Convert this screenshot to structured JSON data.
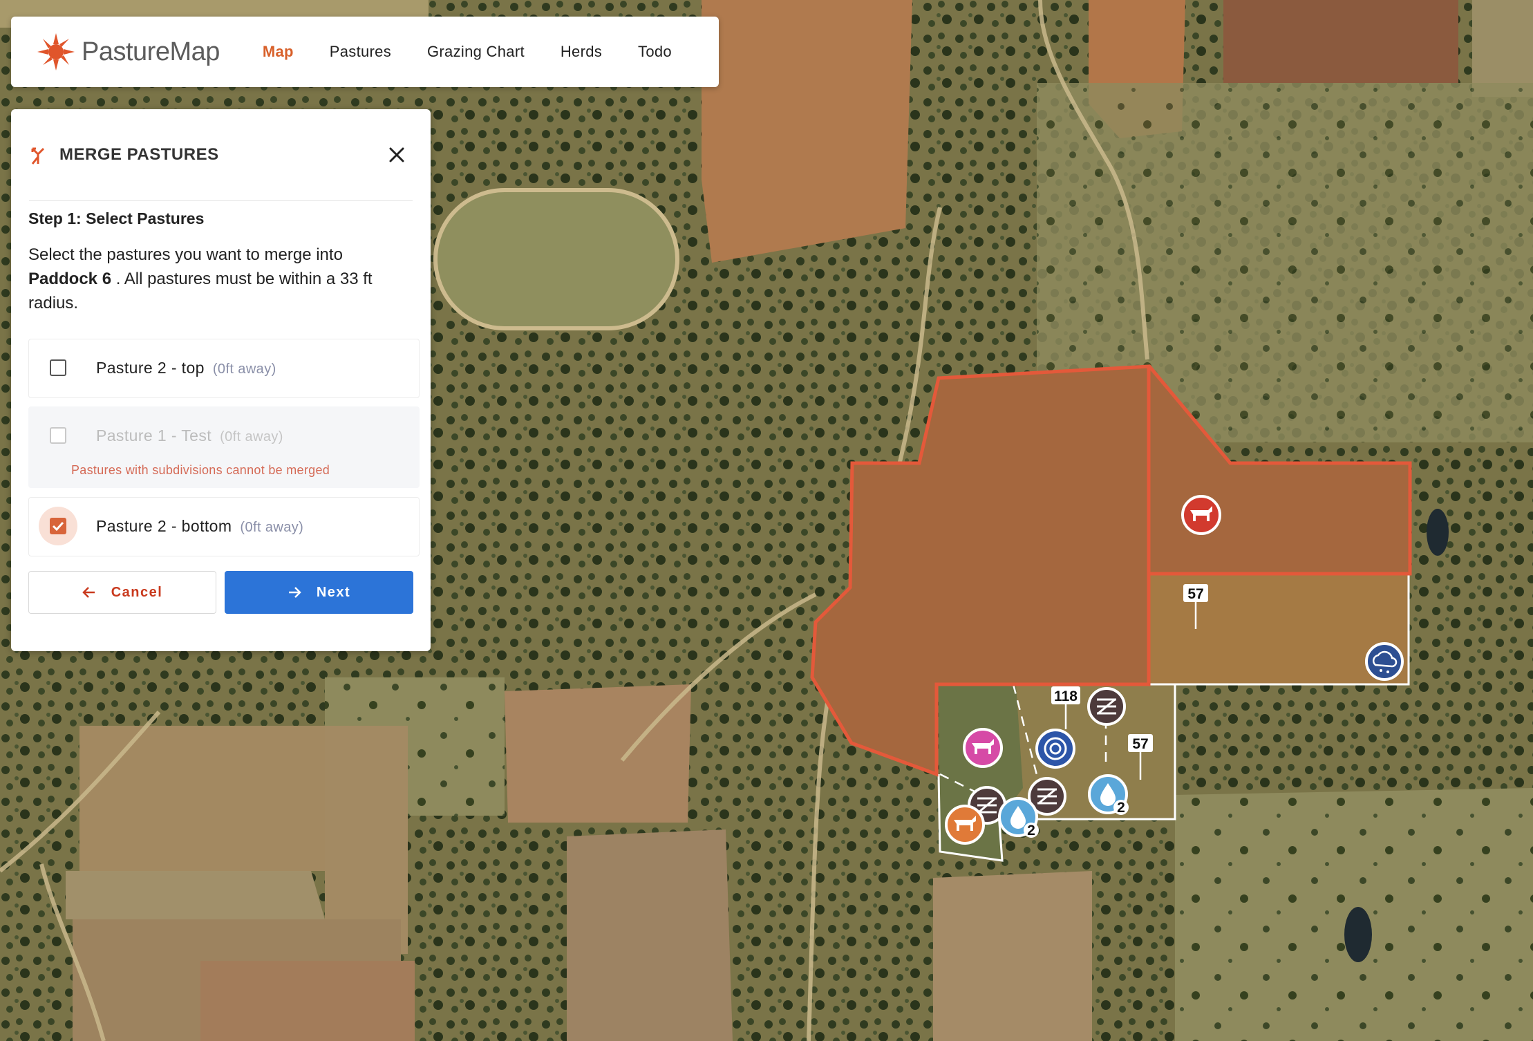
{
  "app": {
    "name": "PastureMap"
  },
  "nav": {
    "items": [
      {
        "label": "Map",
        "active": true
      },
      {
        "label": "Pastures"
      },
      {
        "label": "Grazing Chart"
      },
      {
        "label": "Herds"
      },
      {
        "label": "Todo"
      }
    ]
  },
  "panel": {
    "title": "MERGE PASTURES",
    "step_title": "Step 1: Select Pastures",
    "desc_before": "Select the pastures you want to merge into ",
    "desc_target": "Paddock 6",
    "desc_after": " . All pastures must be within a 33 ft radius.",
    "options": [
      {
        "label": "Pasture 2 - top",
        "distance": "(0ft away)",
        "checked": false,
        "disabled": false
      },
      {
        "label": "Pasture 1 - Test",
        "distance": "(0ft away)",
        "checked": false,
        "disabled": true,
        "error": "Pastures with subdivisions cannot be merged"
      },
      {
        "label": "Pasture 2 - bottom",
        "distance": "(0ft away)",
        "checked": true,
        "disabled": false
      }
    ],
    "cancel_label": "Cancel",
    "next_label": "Next"
  },
  "map": {
    "labels": [
      "57",
      "118",
      "57"
    ],
    "badges": [
      "2",
      "2"
    ],
    "icons": [
      "cow-icon",
      "cow-icon",
      "cow-icon",
      "rain-gauge-icon",
      "target-icon",
      "gate-icon",
      "gate-icon",
      "gate-icon",
      "water-drop-icon",
      "water-drop-icon"
    ]
  },
  "colors": {
    "accent": "#d8602a",
    "primary_button": "#2c74d8",
    "cancel_text": "#c93a1e",
    "selected_outline": "#e4593a"
  }
}
